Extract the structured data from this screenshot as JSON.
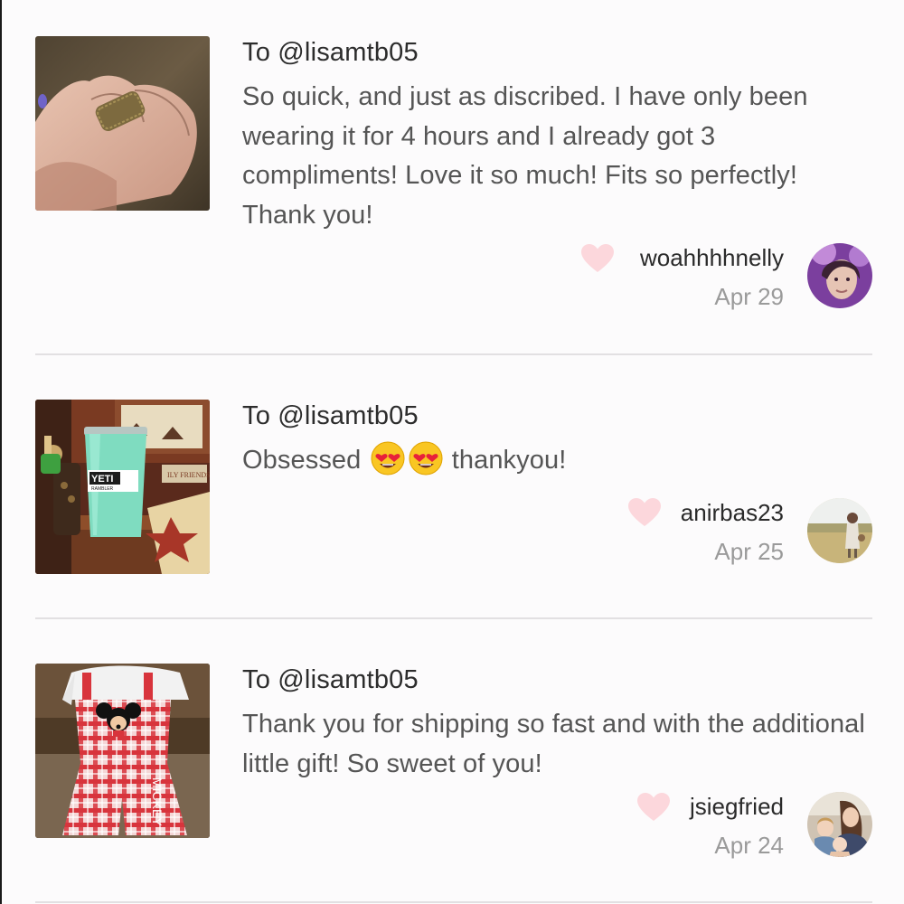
{
  "reviews": [
    {
      "to": "To @lisamtb05",
      "text": "So quick, and just as discribed. I have only been wearing it for 4 hours and I already got 3 compliments! Love it so much! Fits so perfectly! Thank you!",
      "username": "woahhhhnelly",
      "date": "Apr 29",
      "photo": "ring-on-finger",
      "liked": false
    },
    {
      "to": "To @lisamtb05",
      "text_before": "Obsessed",
      "emojis": [
        "heart-eyes-emoji",
        "heart-eyes-emoji"
      ],
      "text_after": "thankyou!",
      "username": "anirbas23",
      "date": "Apr 25",
      "photo": "yeti-tumbler",
      "photo_text": [
        "YETI",
        "RAMBLER",
        "ILY FRIENDS"
      ],
      "liked": false
    },
    {
      "to": "To @lisamtb05",
      "text": "Thank you for shipping so fast and with the additional little gift! So sweet of you!",
      "username": "jsiegfried",
      "date": "Apr 24",
      "photo": "mickey-overalls",
      "photo_text": [
        "MICKEY"
      ],
      "liked": false
    }
  ],
  "colors": {
    "background": "#fcfbfc",
    "heart": "#fcd7dc",
    "divider": "#e2e0e2",
    "primary_text": "#2c2c2c",
    "body_text": "#555555",
    "muted_text": "#9a9a9a"
  }
}
